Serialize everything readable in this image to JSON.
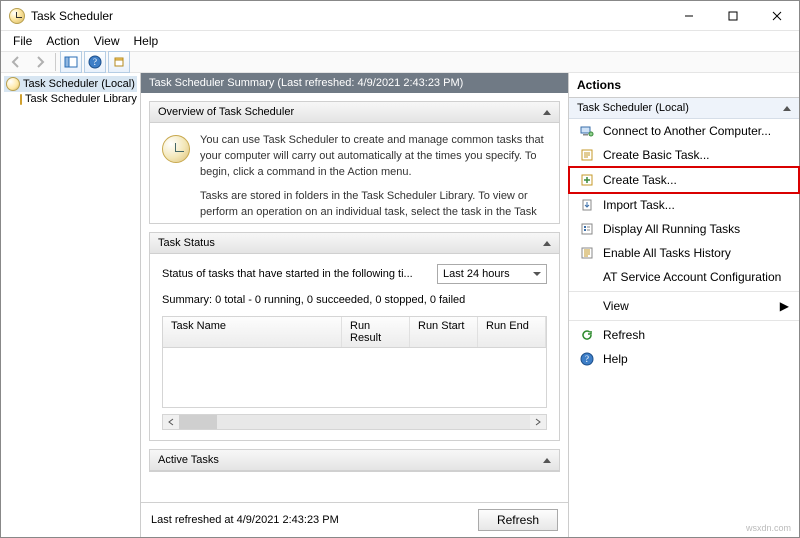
{
  "window": {
    "title": "Task Scheduler"
  },
  "menubar": {
    "file": "File",
    "action": "Action",
    "view": "View",
    "help": "Help"
  },
  "tree": {
    "root": "Task Scheduler (Local)",
    "library": "Task Scheduler Library"
  },
  "summary": {
    "header": "Task Scheduler Summary (Last refreshed: 4/9/2021 2:43:23 PM)"
  },
  "overview": {
    "title": "Overview of Task Scheduler",
    "para1": "You can use Task Scheduler to create and manage common tasks that your computer will carry out automatically at the times you specify. To begin, click a command in the Action menu.",
    "para2": "Tasks are stored in folders in the Task Scheduler Library. To view or perform an operation on an individual task, select the task in the Task Scheduler Library and click on a command in the Action menu"
  },
  "task_status": {
    "title": "Task Status",
    "filter_label": "Status of tasks that have started in the following ti...",
    "filter_value": "Last 24 hours",
    "summary_line": "Summary: 0 total - 0 running, 0 succeeded, 0 stopped, 0 failed",
    "columns": {
      "name": "Task Name",
      "run_result": "Run Result",
      "run_start": "Run Start",
      "run_end": "Run End"
    }
  },
  "active_tasks": {
    "title": "Active Tasks"
  },
  "footer": {
    "last_refreshed": "Last refreshed at 4/9/2021 2:43:23 PM",
    "refresh": "Refresh"
  },
  "actions": {
    "title": "Actions",
    "scope": "Task Scheduler (Local)",
    "items": [
      "Connect to Another Computer...",
      "Create Basic Task...",
      "Create Task...",
      "Import Task...",
      "Display All Running Tasks",
      "Enable All Tasks History",
      "AT Service Account Configuration"
    ],
    "view": "View",
    "refresh": "Refresh",
    "help": "Help"
  },
  "watermark": "wsxdn.com"
}
